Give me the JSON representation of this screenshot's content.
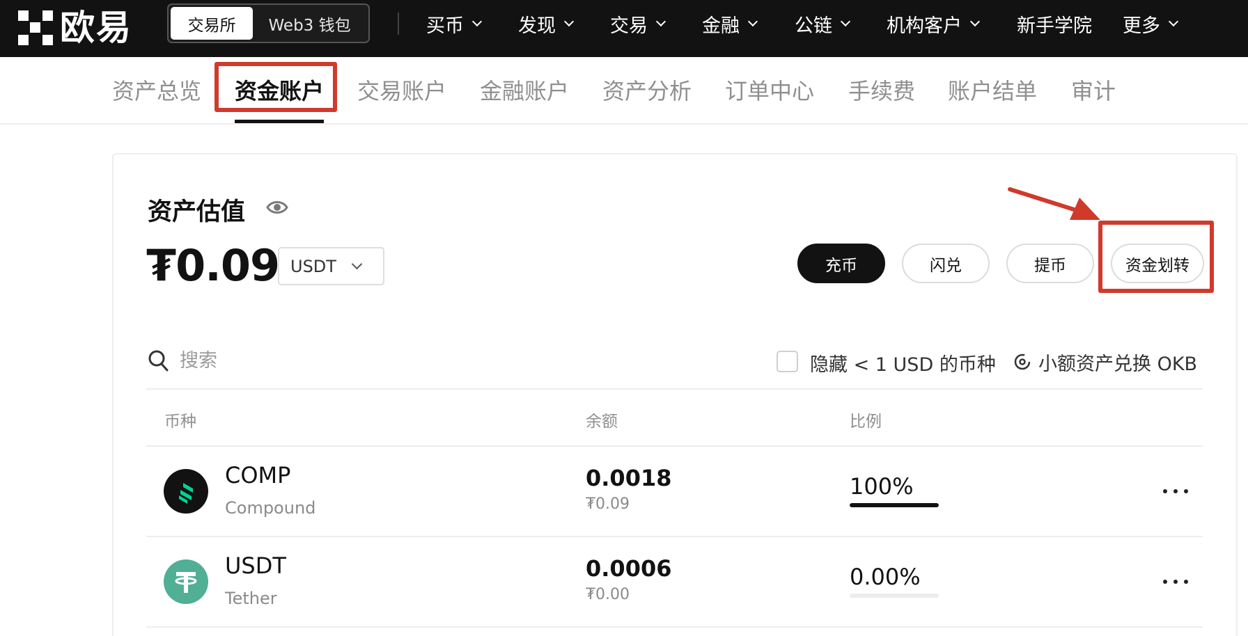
{
  "header": {
    "logo_text": "欧易",
    "switcher": {
      "active": "交易所",
      "other": "Web3 钱包"
    },
    "nav": [
      {
        "label": "买币",
        "has_dropdown": true
      },
      {
        "label": "发现",
        "has_dropdown": true
      },
      {
        "label": "交易",
        "has_dropdown": true
      },
      {
        "label": "金融",
        "has_dropdown": true
      },
      {
        "label": "公链",
        "has_dropdown": true
      },
      {
        "label": "机构客户",
        "has_dropdown": true
      },
      {
        "label": "新手学院",
        "has_dropdown": false
      },
      {
        "label": "更多",
        "has_dropdown": true
      }
    ]
  },
  "subtabs": [
    "资产总览",
    "资金账户",
    "交易账户",
    "金融账户",
    "资产分析",
    "订单中心",
    "手续费",
    "账户结单",
    "审计"
  ],
  "subtabs_active": "资金账户",
  "overview": {
    "title": "资产估值",
    "value": "₮0.09",
    "currency": "USDT",
    "actions": {
      "deposit": "充币",
      "convert": "闪兑",
      "withdraw": "提币",
      "transfer": "资金划转"
    }
  },
  "filters": {
    "search_placeholder": "搜索",
    "hide_small": "隐藏 < 1 USD 的币种",
    "convert_small": "小额资产兑换 OKB"
  },
  "table": {
    "headers": {
      "coin": "币种",
      "balance": "余额",
      "ratio": "比例"
    },
    "rows": [
      {
        "symbol": "COMP",
        "name": "Compound",
        "balance": "0.0018",
        "fiat": "₮0.09",
        "ratio": "100%",
        "ratio_value": 1.0,
        "logo_color": "#121212",
        "logo_accent": "#00d395"
      },
      {
        "symbol": "USDT",
        "name": "Tether",
        "balance": "0.0006",
        "fiat": "₮0.00",
        "ratio": "0.00%",
        "ratio_value": 0.0,
        "logo_color": "#50af95",
        "logo_accent": "#ffffff"
      }
    ]
  },
  "annotation_color": "#d03a2b"
}
